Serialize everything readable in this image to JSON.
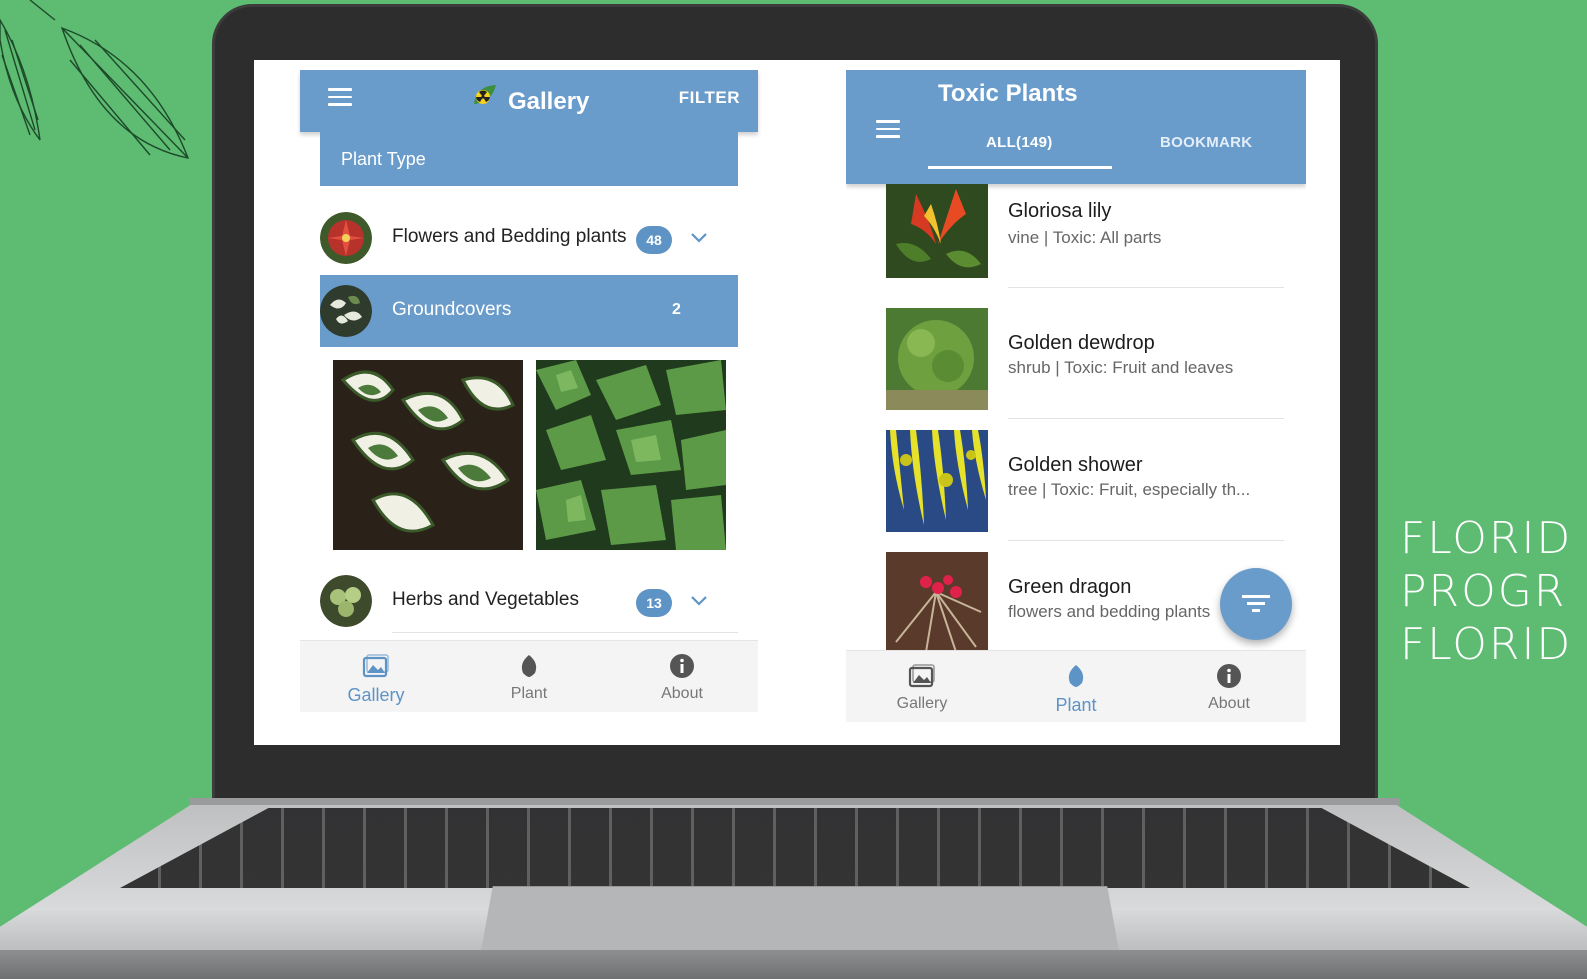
{
  "side_text": [
    "FLORID",
    "PROGR",
    "FLORID"
  ],
  "left_screen": {
    "title": "Gallery",
    "filter_label": "FILTER",
    "plant_type_label": "Plant Type",
    "categories": [
      {
        "label": "Flowers and Bedding plants",
        "count": "48"
      },
      {
        "label": "Groundcovers",
        "count": "2"
      },
      {
        "label": "Herbs and Vegetables",
        "count": "13"
      }
    ],
    "nav": {
      "gallery": "Gallery",
      "plant": "Plant",
      "about": "About"
    },
    "active_nav": "gallery"
  },
  "right_screen": {
    "title": "Toxic Plants",
    "tabs": [
      "ALL(149)",
      "BOOKMARK"
    ],
    "plants": [
      {
        "name": "Gloriosa lily",
        "desc": "vine | Toxic: All parts"
      },
      {
        "name": "Golden dewdrop",
        "desc": "shrub | Toxic: Fruit and leaves"
      },
      {
        "name": "Golden shower",
        "desc": "tree | Toxic: Fruit, especially th..."
      },
      {
        "name": "Green dragon",
        "desc": "flowers and bedding plants"
      }
    ],
    "nav": {
      "gallery": "Gallery",
      "plant": "Plant",
      "about": "About"
    },
    "active_nav": "plant"
  },
  "colors": {
    "background": "#5dbb72",
    "appbar": "#6a9ccb",
    "accent": "#5e93c6"
  }
}
